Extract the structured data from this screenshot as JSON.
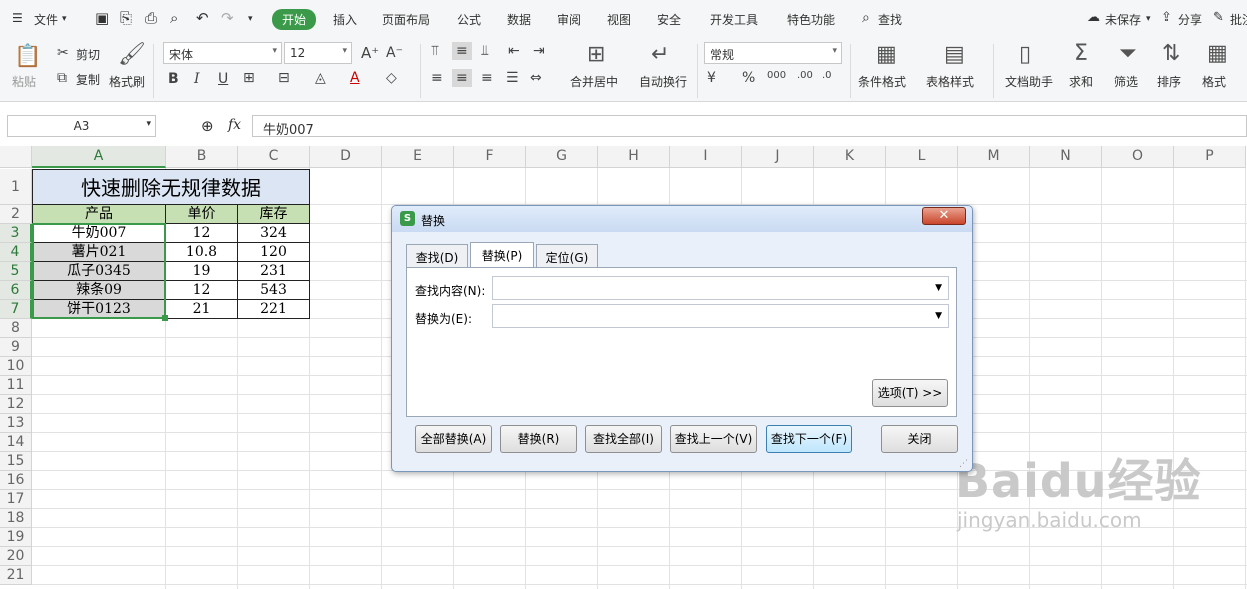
{
  "menubar": {
    "file": "文件",
    "tabs": [
      "开始",
      "插入",
      "页面布局",
      "公式",
      "数据",
      "审阅",
      "视图",
      "安全",
      "开发工具",
      "特色功能"
    ],
    "search": "查找",
    "unsaved": "未保存",
    "share": "分享",
    "batch": "批注"
  },
  "ribbon": {
    "paste": "粘贴",
    "cut": "剪切",
    "copy": "复制",
    "format_painter": "格式刷",
    "font_name": "宋体",
    "font_size": "12",
    "merge_center": "合并居中",
    "wrap_text": "自动换行",
    "number_format": "常规",
    "cond_format": "条件格式",
    "table_style": "表格样式",
    "doc_helper": "文档助手",
    "sum": "求和",
    "filter": "筛选",
    "sort": "排序",
    "format": "格式"
  },
  "formula_bar": {
    "name_box": "A3",
    "fx": "fx",
    "content": "牛奶007"
  },
  "columns": [
    "A",
    "B",
    "C",
    "D",
    "E",
    "F",
    "G",
    "H",
    "I",
    "J",
    "K",
    "L",
    "M",
    "N",
    "O",
    "P"
  ],
  "rows": [
    "1",
    "2",
    "3",
    "4",
    "5",
    "6",
    "7",
    "8",
    "9",
    "10",
    "11",
    "12",
    "13",
    "14",
    "15",
    "16",
    "17",
    "18",
    "19",
    "20",
    "21"
  ],
  "sheet": {
    "title": "快速删除无规律数据",
    "headers": [
      "产品",
      "单价",
      "库存"
    ],
    "data": [
      [
        "牛奶007",
        "12",
        "324"
      ],
      [
        "薯片021",
        "10.8",
        "120"
      ],
      [
        "瓜子0345",
        "19",
        "231"
      ],
      [
        "辣条09",
        "12",
        "543"
      ],
      [
        "饼干0123",
        "21",
        "221"
      ]
    ]
  },
  "dialog": {
    "title": "替换",
    "tabs": [
      "查找(D)",
      "替换(P)",
      "定位(G)"
    ],
    "find_label": "查找内容(N):",
    "replace_label": "替换为(E):",
    "find_value": "",
    "replace_value": "",
    "options": "选项(T) >>",
    "buttons": [
      "全部替换(A)",
      "替换(R)",
      "查找全部(I)",
      "查找上一个(V)",
      "查找下一个(F)",
      "关闭"
    ]
  },
  "watermark": {
    "brand": "Baidu经验",
    "url": "jingyan.baidu.com"
  },
  "colors": {
    "accent": "#3a9a4a",
    "title_fill": "#dbe5f3",
    "header_fill": "#c6e0b4",
    "selected_fill": "#d9d9d9"
  }
}
